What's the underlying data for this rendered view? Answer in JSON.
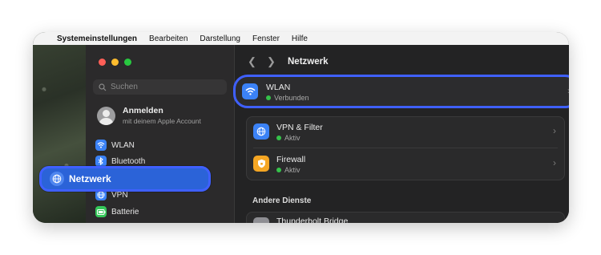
{
  "menubar": {
    "app_name": "Systemeinstellungen",
    "items": [
      "Bearbeiten",
      "Darstellung",
      "Fenster",
      "Hilfe"
    ]
  },
  "sidebar": {
    "search_placeholder": "Suchen",
    "account": {
      "name": "Anmelden",
      "subtitle": "mit deinem Apple Account"
    },
    "items": [
      {
        "label": "WLAN",
        "icon": "wifi-icon",
        "color": "#3b82f6"
      },
      {
        "label": "Bluetooth",
        "icon": "bluetooth-icon",
        "color": "#3b82f6"
      },
      {
        "label": "Netzwerk",
        "icon": "globe-icon",
        "color": "#3b82f6",
        "selected": true
      },
      {
        "label": "VPN",
        "icon": "globe-icon",
        "color": "#3b82f6"
      },
      {
        "label": "Batterie",
        "icon": "battery-icon",
        "color": "#34c759"
      }
    ]
  },
  "main": {
    "title": "Netzwerk",
    "wlan": {
      "title": "WLAN",
      "status": "Verbunden"
    },
    "services": [
      {
        "title": "VPN & Filter",
        "status": "Aktiv",
        "icon": "vpn-globe-icon",
        "color": "#3b82f6"
      },
      {
        "title": "Firewall",
        "status": "Aktiv",
        "icon": "shield-icon",
        "color": "#f5a623"
      }
    ],
    "other_section_title": "Andere Dienste",
    "other_services": [
      {
        "title": "Thunderbolt Bridge"
      }
    ]
  },
  "colors": {
    "accent": "#3f60ff",
    "status_green": "#35c24a"
  }
}
